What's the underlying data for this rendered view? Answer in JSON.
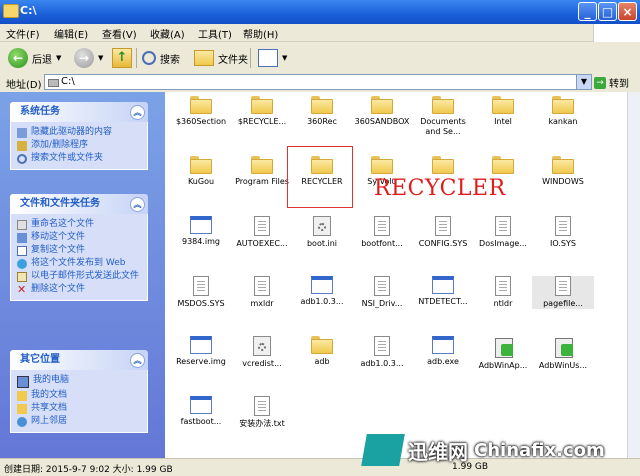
{
  "window": {
    "title": "C:\\"
  },
  "menu": [
    "文件(F)",
    "编辑(E)",
    "查看(V)",
    "收藏(A)",
    "工具(T)",
    "帮助(H)"
  ],
  "toolbar": {
    "back": "后退",
    "search": "搜索",
    "folders": "文件夹"
  },
  "address": {
    "label": "地址(D)",
    "value": "C:\\",
    "go": "转到"
  },
  "sidebar": {
    "system_tasks": {
      "title": "系统任务",
      "items": [
        "隐藏此驱动器的内容",
        "添加/删除程序",
        "搜索文件或文件夹"
      ]
    },
    "file_tasks": {
      "title": "文件和文件夹任务",
      "items": [
        "重命名这个文件",
        "移动这个文件",
        "复制这个文件",
        "将这个文件发布到 Web",
        "以电子邮件形式发送此文件",
        "删除这个文件"
      ]
    },
    "other_places": {
      "title": "其它位置",
      "items": [
        "我的电脑",
        "我的文档",
        "共享文档",
        "网上邻居"
      ]
    }
  },
  "files": [
    {
      "name": "$360Section",
      "icon": "folder"
    },
    {
      "name": "$RECYCLE...",
      "icon": "folder"
    },
    {
      "name": "360Rec",
      "icon": "folder"
    },
    {
      "name": "360SANDBOX",
      "icon": "folder"
    },
    {
      "name": "Documents and Se...",
      "icon": "folder"
    },
    {
      "name": "Intel",
      "icon": "folder"
    },
    {
      "name": "kankan",
      "icon": "folder"
    },
    {
      "name": "KuGou",
      "icon": "folder"
    },
    {
      "name": "Program Files",
      "icon": "folder"
    },
    {
      "name": "RECYCLER",
      "icon": "folder"
    },
    {
      "name": "Sy Volu",
      "icon": "folder"
    },
    {
      "name": "",
      "icon": "folder"
    },
    {
      "name": "",
      "icon": "folder"
    },
    {
      "name": "WINDOWS",
      "icon": "folder"
    },
    {
      "name": "9384.img",
      "icon": "window"
    },
    {
      "name": "AUTOEXEC...",
      "icon": "document"
    },
    {
      "name": "boot.ini",
      "icon": "settings"
    },
    {
      "name": "bootfont...",
      "icon": "document"
    },
    {
      "name": "CONFIG.SYS",
      "icon": "document"
    },
    {
      "name": "DosImage...",
      "icon": "document"
    },
    {
      "name": "IO.SYS",
      "icon": "document"
    },
    {
      "name": "MSDOS.SYS",
      "icon": "document"
    },
    {
      "name": "mxldr",
      "icon": "document"
    },
    {
      "name": "adb1.0.3...",
      "icon": "window"
    },
    {
      "name": "NSI_Driv...",
      "icon": "document"
    },
    {
      "name": "NTDETECT...",
      "icon": "window"
    },
    {
      "name": "ntldr",
      "icon": "document"
    },
    {
      "name": "pagefile...",
      "icon": "document"
    },
    {
      "name": "Reserve.img",
      "icon": "window"
    },
    {
      "name": "vcredist...",
      "icon": "settings"
    },
    {
      "name": "adb",
      "icon": "folder"
    },
    {
      "name": "adb1.0.3...",
      "icon": "document"
    },
    {
      "name": "adb.exe",
      "icon": "window"
    },
    {
      "name": "AdbWinAp...",
      "icon": "installer"
    },
    {
      "name": "AdbWinUs...",
      "icon": "installer"
    },
    {
      "name": "fastboot...",
      "icon": "window"
    },
    {
      "name": "安装办法.txt",
      "icon": "document"
    }
  ],
  "annotation": "RECYCLER",
  "status": {
    "text": "创建日期: 2015-9-7 9:02 大小: 1.99 GB",
    "size": "1.99 GB"
  },
  "watermark": {
    "cn": "迅维网",
    "en": "Chinafix.com"
  }
}
